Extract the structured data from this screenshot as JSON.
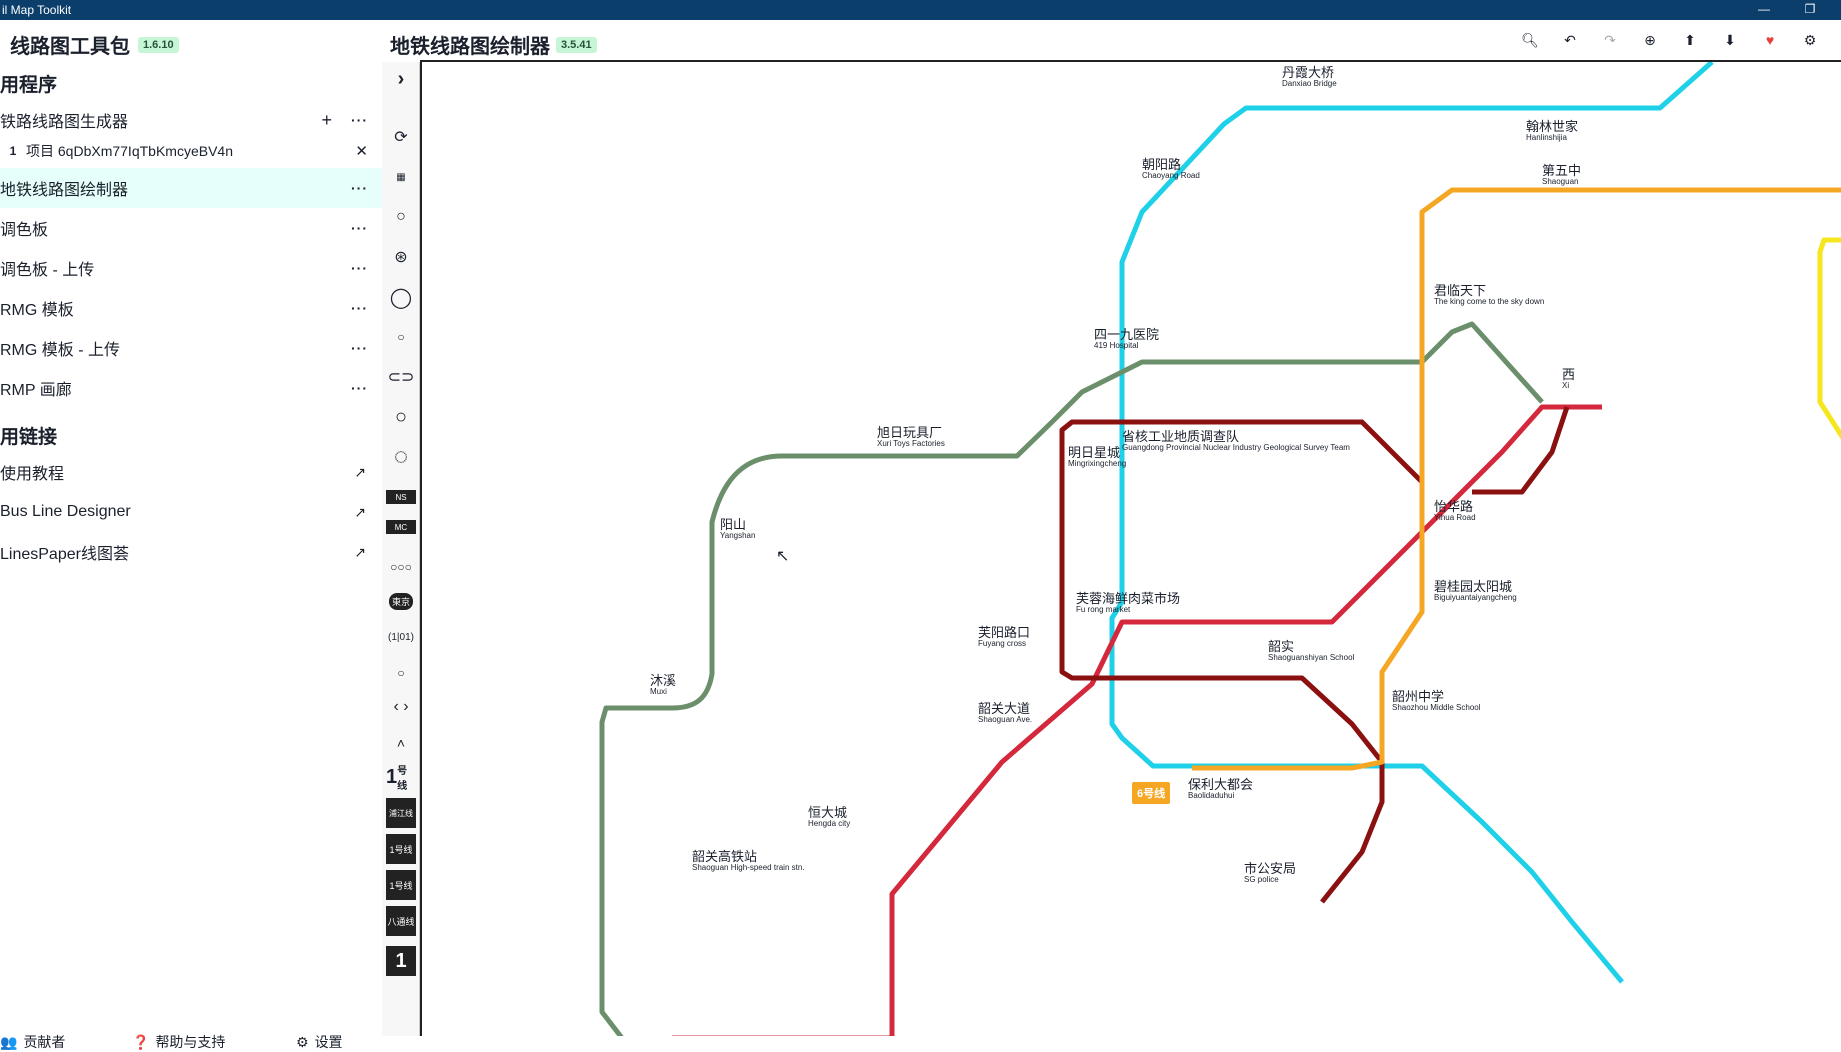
{
  "window": {
    "title": "il Map Toolkit",
    "min": "—",
    "restore": "❐"
  },
  "sidebar": {
    "title": "线路图工具包",
    "version": "1.6.10",
    "apps_heading": "用程序",
    "items": [
      {
        "label": "铁路线路图生成器"
      },
      {
        "label": "项目 6qDbXm77IqTbKmcyeBV4n",
        "number": "1"
      },
      {
        "label": "地铁线路图绘制器"
      },
      {
        "label": "调色板"
      },
      {
        "label": "调色板 - 上传"
      },
      {
        "label": "RMG 模板"
      },
      {
        "label": "RMG 模板 - 上传"
      },
      {
        "label": "RMP 画廊"
      }
    ],
    "links_heading": "用链接",
    "links": [
      {
        "label": "使用教程"
      },
      {
        "label": "Bus Line Designer"
      },
      {
        "label": "LinesPaper线图荟"
      }
    ],
    "footer": {
      "contributors": "贡献者",
      "help": "帮助与支持",
      "settings": "设置"
    }
  },
  "main": {
    "title": "地铁线路图绘制器",
    "version": "3.5.41",
    "toolbar_icons": [
      "search-icon",
      "undo-icon",
      "redo-icon",
      "zoom-in-icon",
      "upload-icon",
      "download-icon",
      "heart-icon",
      "gear-icon"
    ],
    "heart_color": "#e53e3e"
  },
  "tools": {
    "line_badges": {
      "a": "号线",
      "b": "浦江线",
      "c": "1号线",
      "d": "八通线",
      "tokyo": "東京"
    }
  },
  "map": {
    "line_colors": {
      "teal": "#1ed0e8",
      "green": "#6b8f6b",
      "red": "#d4283d",
      "darkred": "#8b1010",
      "orange": "#f5a623",
      "yellow": "#f5e61e"
    },
    "line6_badge": "6号线",
    "stations": [
      {
        "zh": "丹霞大桥",
        "en": "Danxiao Bridge"
      },
      {
        "zh": "翰林世家",
        "en": "Hanlinshijia"
      },
      {
        "zh": "第五中",
        "en": "Shaoguan"
      },
      {
        "zh": "朝阳路",
        "en": "Chaoyang Road"
      },
      {
        "zh": "君临天下",
        "en": "The king come to the sky down"
      },
      {
        "zh": "四一九医院",
        "en": "419 Hospital"
      },
      {
        "zh": "旭日玩具厂",
        "en": "Xuri Toys Factories"
      },
      {
        "zh": "省核工业地质调查队",
        "en": "Guangdong Provincial Nuclear Industry Geological Survey Team"
      },
      {
        "zh": "明日星城",
        "en": "Mingrixingcheng"
      },
      {
        "zh": "怡华路",
        "en": "Yihua Road"
      },
      {
        "zh": "阳山",
        "en": "Yangshan"
      },
      {
        "zh": "碧桂园太阳城",
        "en": "Biguiyuantaiyangcheng"
      },
      {
        "zh": "芙蓉海鲜肉菜市场",
        "en": "Fu rong market"
      },
      {
        "zh": "芙阳路口",
        "en": "Fuyang cross"
      },
      {
        "zh": "韶实",
        "en": "Shaoguanshiyan School"
      },
      {
        "zh": "沐溪",
        "en": "Muxi"
      },
      {
        "zh": "韶州中学",
        "en": "Shaozhou Middle School"
      },
      {
        "zh": "韶关大道",
        "en": "Shaoguan Ave."
      },
      {
        "zh": "保利大都会",
        "en": "Baolidaduhui"
      },
      {
        "zh": "恒大城",
        "en": "Hengda city"
      },
      {
        "zh": "韶关高铁站",
        "en": "Shaoguan High-speed train stn."
      },
      {
        "zh": "市公安局",
        "en": "SG police"
      },
      {
        "zh": "西",
        "en": "Xi"
      }
    ]
  }
}
